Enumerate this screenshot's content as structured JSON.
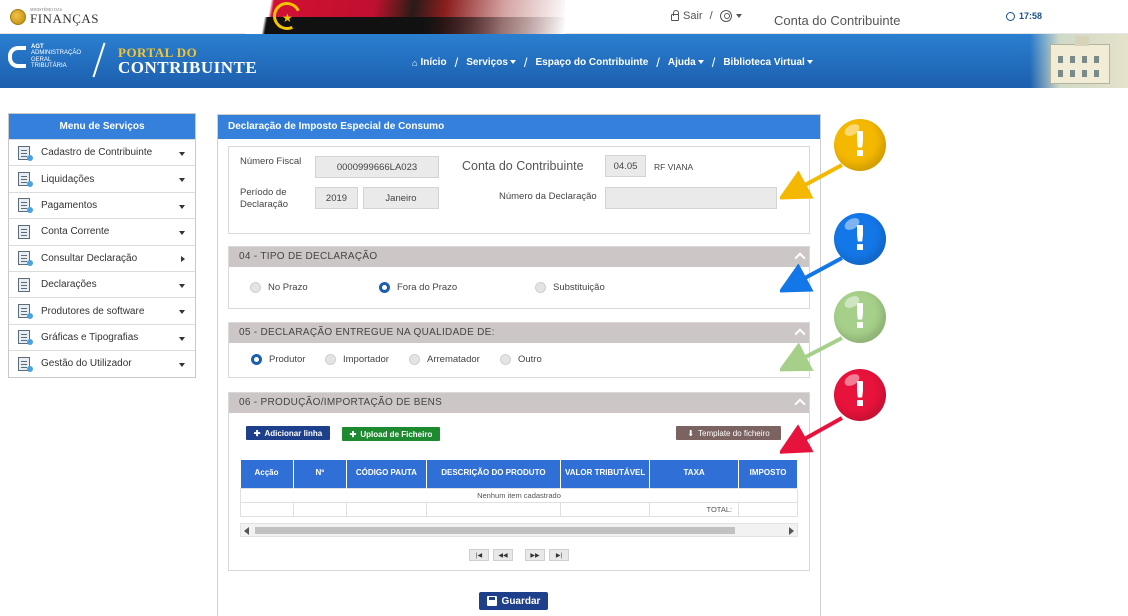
{
  "topbar": {
    "ministry_small": "MINISTÉRIO DAS",
    "ministry": "FINANÇAS",
    "logout": "Sair",
    "sep": "/",
    "title": "Conta do Contribuinte",
    "time": "17:58"
  },
  "header": {
    "agt_abbr": "AGT",
    "agt_line1": "ADMINISTRAÇÃO",
    "agt_line2": "GERAL",
    "agt_line3": "TRIBUTÁRIA",
    "portal_line1": "PORTAL DO",
    "portal_line2": "CONTRIBUINTE",
    "nav": {
      "home": "Início",
      "services": "Serviços",
      "taxpayer_space": "Espaço do Contribuinte",
      "help": "Ajuda",
      "library": "Biblioteca Virtual"
    }
  },
  "sidebar": {
    "title": "Menu de Serviços",
    "items": [
      {
        "label": "Cadastro de Contribuinte"
      },
      {
        "label": "Liquidações"
      },
      {
        "label": "Pagamentos"
      },
      {
        "label": "Conta Corrente"
      },
      {
        "label": "Consultar Declaração"
      },
      {
        "label": "Declarações"
      },
      {
        "label": "Produtores de software"
      },
      {
        "label": "Gráficas e Tipografias"
      },
      {
        "label": "Gestão do Utilizador"
      }
    ]
  },
  "main": {
    "title": "Declaração de Imposto Especial de Consumo",
    "taxpayer": {
      "nif_label": "Número Fiscal",
      "nif_value": "0000999666LA023",
      "account_label": "Conta do Contribuinte",
      "office_code": "04.05",
      "office_name": "RF VIANA",
      "period_label": "Período de Declaração",
      "year": "2019",
      "month": "Janeiro",
      "decl_number_label": "Número da Declaração",
      "decl_number_value": ""
    },
    "section_type": {
      "title": "04 - TIPO DE DECLARAÇÃO",
      "options": [
        "No Prazo",
        "Fora do Prazo",
        "Substituição"
      ],
      "selected": "Fora do Prazo"
    },
    "section_quality": {
      "title": "05 - DECLARAÇÃO ENTREGUE NA QUALIDADE DE:",
      "options": [
        "Produtor",
        "Importador",
        "Arrematador",
        "Outro"
      ],
      "selected": "Produtor"
    },
    "section_goods": {
      "title": "06 - PRODUÇÃO/IMPORTAÇÃO DE BENS",
      "add_line": "Adicionar linha",
      "upload": "Upload de Ficheiro",
      "template": "Template do ficheiro",
      "columns": [
        "Acção",
        "Nº",
        "CÓDIGO PAUTA",
        "DESCRIÇÃO DO PRODUTO",
        "VALOR TRIBUTÁVEL",
        "TAXA",
        "IMPOSTO"
      ],
      "empty_text": "Nenhum item cadastrado",
      "total_label": "TOTAL:",
      "pager": [
        "|◀",
        "◀◀",
        "▶▶",
        "▶|"
      ]
    },
    "save": "Guardar"
  },
  "annotations": {
    "colors": [
      "#f5b800",
      "#1477e8",
      "#a6d08a",
      "#e8133c"
    ],
    "icon": "exclamation-icon",
    "mark": "!"
  }
}
